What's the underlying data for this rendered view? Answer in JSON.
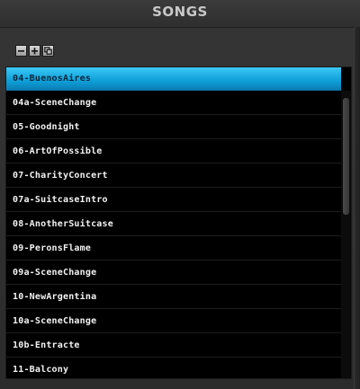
{
  "header": {
    "title": "SONGS"
  },
  "toolbar": {
    "buttons": [
      {
        "name": "remove",
        "icon": "minus-icon"
      },
      {
        "name": "add",
        "icon": "plus-icon"
      },
      {
        "name": "duplicate",
        "icon": "duplicate-icon"
      }
    ]
  },
  "songs": {
    "selected_index": 0,
    "accent": "#1ba9e4",
    "items": [
      "04-BuenosAires",
      "04a-SceneChange",
      "05-Goodnight",
      "06-ArtOfPossible",
      "07-CharityConcert",
      "07a-SuitcaseIntro",
      "08-AnotherSuitcase",
      "09-PeronsFlame",
      "09a-SceneChange",
      "10-NewArgentina",
      "10a-SceneChange",
      "10b-Entracte",
      "11-Balcony"
    ]
  }
}
